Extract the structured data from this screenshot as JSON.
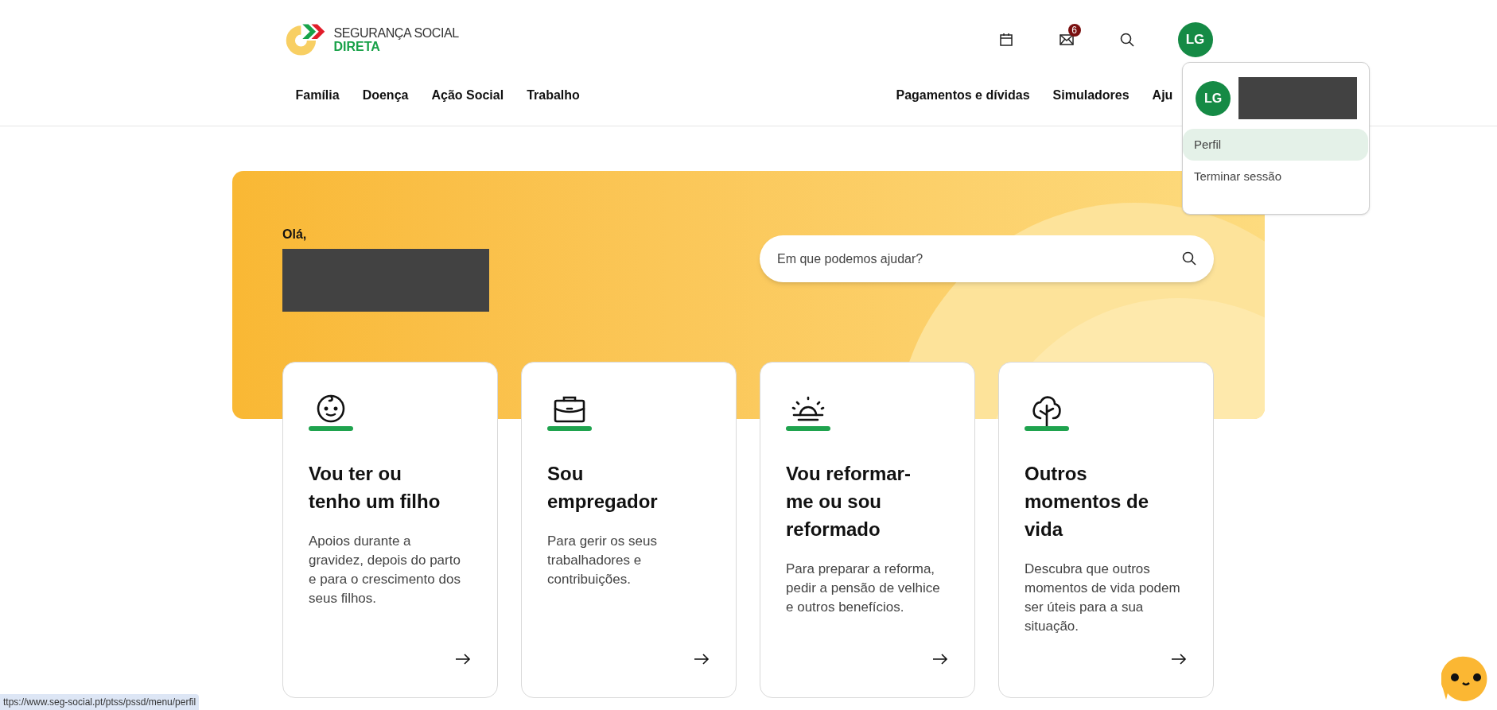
{
  "header": {
    "logo": {
      "line1": "SEGURANÇA SOCIAL",
      "line2": "DIRETA"
    },
    "mail_badge": "6",
    "avatar": "LG"
  },
  "nav_left": [
    "Família",
    "Doença",
    "Ação Social",
    "Trabalho"
  ],
  "nav_right": [
    "Pagamentos e dívidas",
    "Simuladores",
    "Aju"
  ],
  "hero": {
    "greeting": "Olá,",
    "search": {
      "placeholder": "Em que podemos ajudar?"
    }
  },
  "cards": [
    {
      "kind": "baby",
      "title": "Vou ter ou tenho um filho",
      "description": "Apoios durante a gravidez, depois do parto e para o crescimento dos seus filhos."
    },
    {
      "kind": "briefcase",
      "title": "Sou empregador",
      "description": "Para gerir os seus trabalhadores e contribuições."
    },
    {
      "kind": "sunset",
      "title": "Vou reformar-me ou sou reformado",
      "description": "Para preparar a reforma, pedir a pensão de velhice e outros benefícios."
    },
    {
      "kind": "tree",
      "title": "Outros momentos de vida",
      "description": "Descubra que outros momentos de vida podem ser úteis para a sua situação."
    }
  ],
  "user_menu": {
    "avatar": "LG",
    "items": [
      {
        "label": "Perfil",
        "selected": true
      },
      {
        "label": "Terminar sessão",
        "selected": false
      }
    ]
  },
  "status_bar": {
    "url": "ttps://www.seg-social.pt/ptss/pssd/menu/perfil"
  }
}
